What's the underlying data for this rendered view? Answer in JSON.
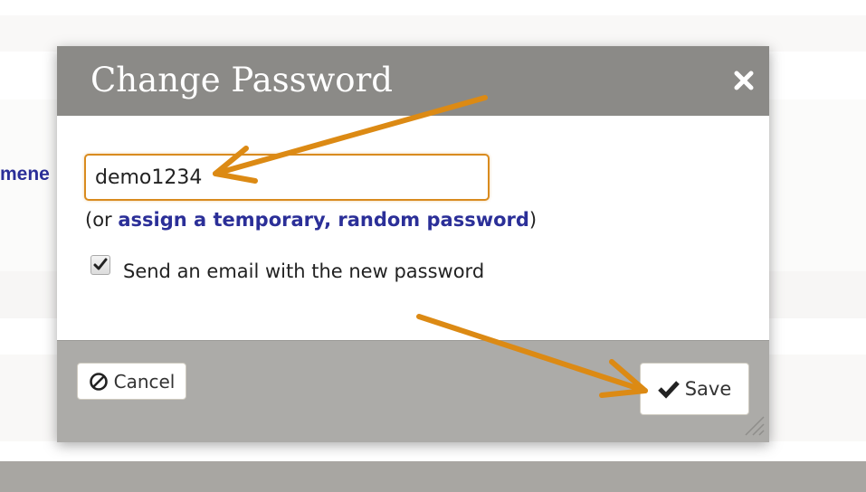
{
  "background": {
    "partial_link_text": "mene"
  },
  "modal": {
    "title": "Change Password",
    "close_icon": "close-icon",
    "password_value": "demo1234",
    "or_prefix": "(or ",
    "or_link": "assign a temporary, random password",
    "or_suffix": ")",
    "send_email_checked": true,
    "send_email_label": "Send an email with the new password",
    "cancel_label": "Cancel",
    "cancel_icon": "ban-icon",
    "save_label": "Save",
    "save_icon": "checkmark-icon"
  },
  "annotations": {
    "arrow_color": "#dc8a14",
    "arrow_count": 2
  },
  "colors": {
    "header": "#8b8a87",
    "footer": "#acaba8",
    "link": "#2b2f98",
    "input_border": "#d98b1f"
  }
}
